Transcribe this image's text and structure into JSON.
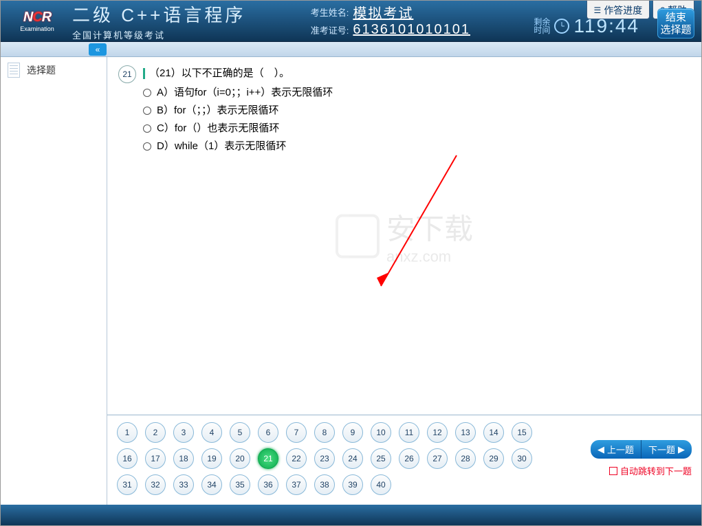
{
  "header": {
    "logo_text": "NCR",
    "logo_sub": "Examination",
    "title": "二级  C++语言程序",
    "subtitle": "全国计算机等级考试",
    "name_label": "考生姓名:",
    "name_value": "模拟考试",
    "id_label": "准考证号:",
    "id_value": "6136101010101",
    "progress_btn": "作答进度",
    "help_btn": "帮助",
    "timer_label_1": "剩余",
    "timer_label_2": "时间",
    "timer_value": "119:44",
    "end_btn_l1": "结束",
    "end_btn_l2": "选择题"
  },
  "sidebar": {
    "item1": "选择题"
  },
  "question": {
    "number": "21",
    "title": "（21）以下不正确的是（　）。",
    "optA": "A）语句for（i=0；；i++）表示无限循环",
    "optB": "B）for（；；）表示无限循环",
    "optC": "C）for（）也表示无限循环",
    "optD": "D）while（1）表示无限循环"
  },
  "nav": {
    "rows": [
      [
        "1",
        "2",
        "3",
        "4",
        "5",
        "6",
        "7",
        "8",
        "9",
        "10",
        "11",
        "12",
        "13",
        "14",
        "15"
      ],
      [
        "16",
        "17",
        "18",
        "19",
        "20",
        "21",
        "22",
        "23",
        "24",
        "25",
        "26",
        "27",
        "28",
        "29",
        "30"
      ],
      [
        "31",
        "32",
        "33",
        "34",
        "35",
        "36",
        "37",
        "38",
        "39",
        "40"
      ]
    ],
    "current": "21",
    "prev": "上一题",
    "next": "下一题",
    "auto": "自动跳转到下一题"
  },
  "watermark": {
    "text1": "安下载",
    "text2": "anxz.com"
  }
}
